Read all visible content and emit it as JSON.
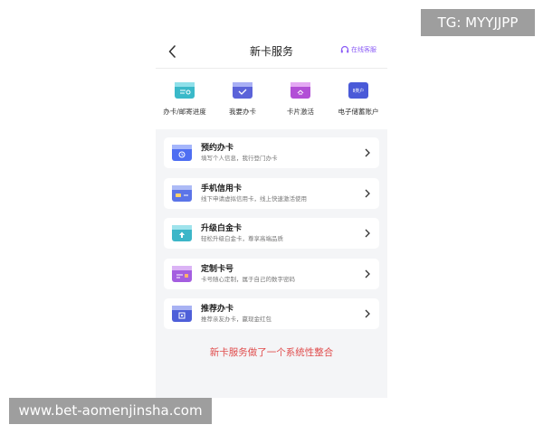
{
  "watermark": {
    "tg": "TG: MYYJJPP",
    "url": "www.bet-aomenjinsha.com"
  },
  "header": {
    "title": "新卡服务",
    "service_label": "在线客服"
  },
  "quick_actions": [
    {
      "label": "办卡/邮寄进度",
      "icon": "progress-card-icon",
      "color": "#3ab9c9"
    },
    {
      "label": "我要办卡",
      "icon": "apply-card-icon",
      "color": "#5b63d9"
    },
    {
      "label": "卡片激活",
      "icon": "activate-card-icon",
      "color": "#b24fd6"
    },
    {
      "label": "电子储蓄账户",
      "icon": "savings-account-icon",
      "color": "#4a5ad8",
      "badge": "Ⅱ类户"
    }
  ],
  "cards": [
    {
      "title": "预约办卡",
      "subtitle": "填写个人信息，我行登门办卡",
      "icon": "appointment-card-icon",
      "color": "#4e6ef2"
    },
    {
      "title": "手机信用卡",
      "subtitle": "线下申请虚拟信用卡，线上快速激活使用",
      "icon": "mobile-credit-card-icon",
      "color": "#5b74e8"
    },
    {
      "title": "升级白金卡",
      "subtitle": "轻松升级白金卡，尊享高端品质",
      "icon": "platinum-upgrade-icon",
      "color": "#3cb6c8"
    },
    {
      "title": "定制卡号",
      "subtitle": "卡号随心定制，属于自己的数字密码",
      "icon": "custom-number-icon",
      "color": "#a45ee0"
    },
    {
      "title": "推荐办卡",
      "subtitle": "推荐亲友办卡，赢现金红包",
      "icon": "referral-card-icon",
      "color": "#4e5fd9"
    }
  ],
  "footer_note": "新卡服务做了一个系统性整合",
  "colors": {
    "accent": "#8b5cf6",
    "note": "#e04b4b",
    "background": "#f4f5f7"
  }
}
